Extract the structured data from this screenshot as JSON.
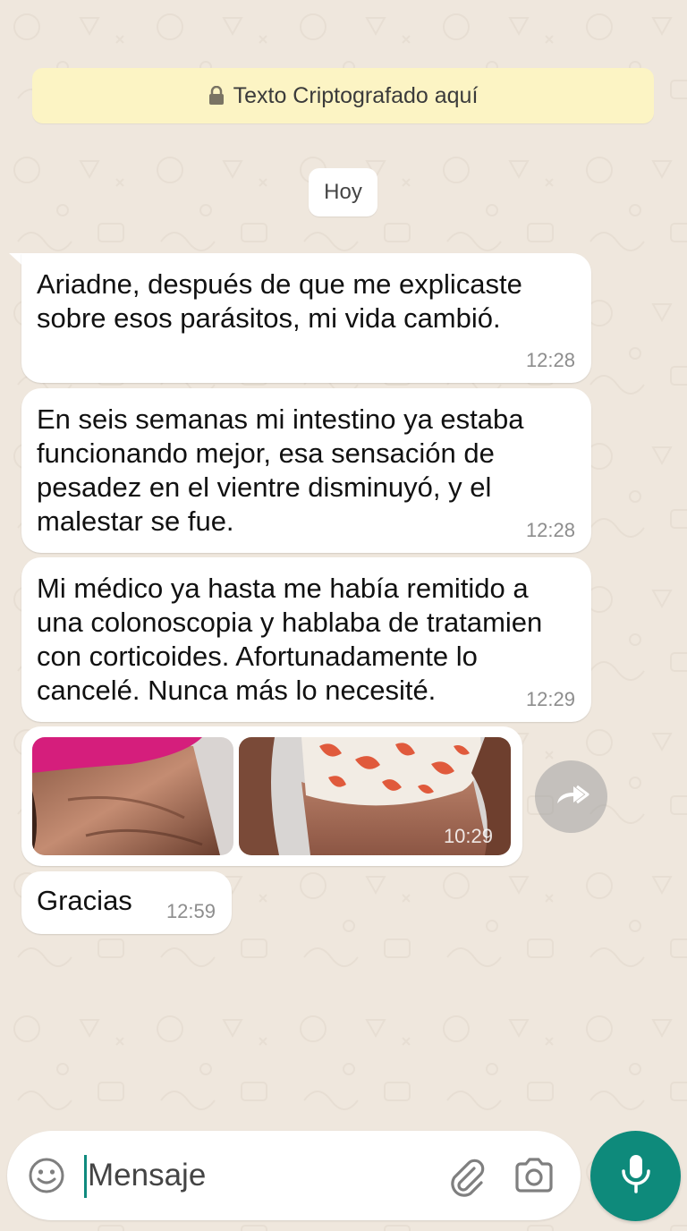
{
  "colors": {
    "wallpaper": "#efe7dd",
    "banner": "#fcf4c4",
    "bubble": "#ffffff",
    "accent": "#0e8a7b",
    "timestamp": "#8d8d8d"
  },
  "banner": {
    "icon": "lock-icon",
    "text": "Texto Criptografado aquí"
  },
  "date_divider": "Hoy",
  "messages": [
    {
      "text": "Ariadne, después de que me explicaste\nsobre esos parásitos, mi vida cambió.",
      "time": "12:28"
    },
    {
      "text": "En seis semanas mi intestino ya estaba\nfuncionando mejor, esa sensación de\npesadez en el vientre disminuyó, y el\nmalestar se fue.",
      "time": "12:28"
    },
    {
      "text": "Mi médico ya hasta me había remitido a\nuna colonoscopia y hablaba de tratamien\ncon corticoides. Afortunadamente lo\ncancelé. Nunca más lo necesité.",
      "time": "12:29"
    },
    {
      "type": "images",
      "images": [
        "photo-before",
        "photo-after"
      ],
      "time": "10:29"
    },
    {
      "text": "Gracias",
      "time": "12:59"
    }
  ],
  "forward_button": {
    "icon": "forward-icon"
  },
  "composer": {
    "placeholder": "Mensaje",
    "emoji_icon": "emoji-icon",
    "attach_icon": "paperclip-icon",
    "camera_icon": "camera-icon",
    "mic_icon": "microphone-icon"
  }
}
